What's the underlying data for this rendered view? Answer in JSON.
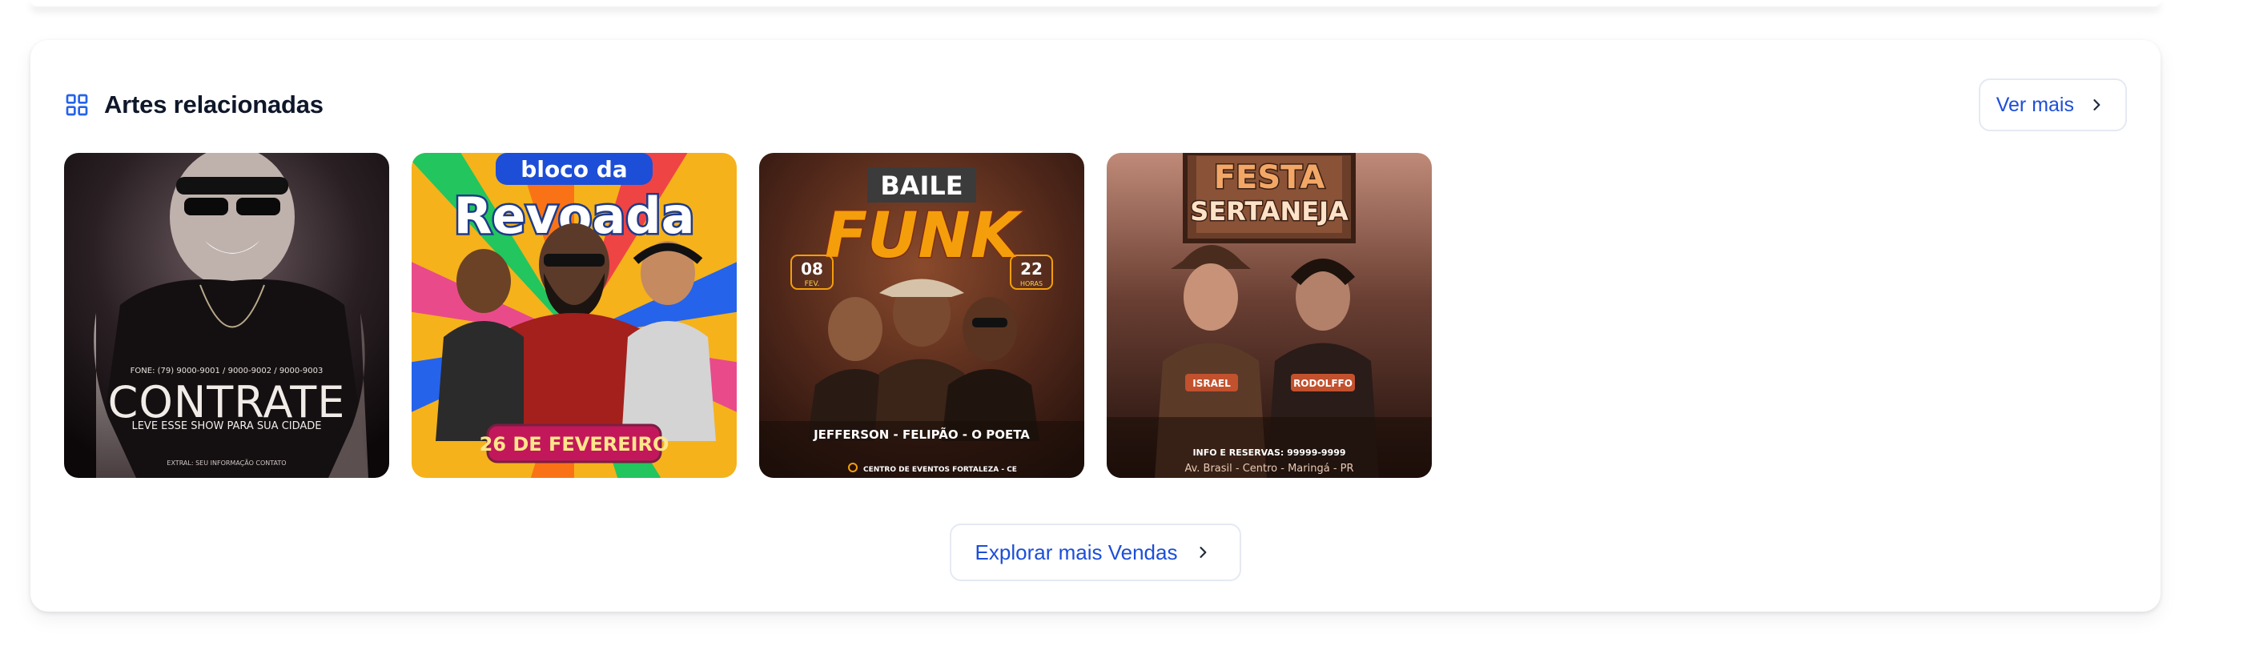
{
  "section": {
    "title": "Artes relacionadas",
    "ver_mais_label": "Ver mais",
    "explore_label": "Explorar mais Vendas"
  },
  "artworks": [
    {
      "name": "contrate",
      "headline": "CONTRATE",
      "tagline": "LEVE ESSE SHOW PARA SUA CIDADE",
      "phones": "FONE: (79) 9000-9001 / 9000-9002 / 9000-9003",
      "footer": "EXTRAL: SEU INFORMAÇÃO CONTATO",
      "palette": [
        "#151015",
        "#3a2a30",
        "#6b5a5e"
      ]
    },
    {
      "name": "bloco-da-revoada",
      "title_top": "bloco da",
      "title_main": "Revoada",
      "date": "26 DE FEVEREIRO",
      "palette": [
        "#f5b21b",
        "#e94b8a",
        "#2563eb",
        "#7c2d12"
      ]
    },
    {
      "name": "baile-funk",
      "title_top": "BAILE",
      "title_main": "FUNK",
      "day": "08",
      "month": "FEV.",
      "hour": "22",
      "hour_label": "HORAS",
      "artists": "JEFFERSON -  FELIPÃO -  O POETA",
      "venue": "CENTRO DE EVENTOS FORTALEZA - CE",
      "palette": [
        "#3b1f17",
        "#7a3a22",
        "#f59e0b"
      ]
    },
    {
      "name": "festa-sertaneja",
      "title_top": "FESTA",
      "title_main": "SERTANEJA",
      "artist_1": "ISRAEL",
      "artist_2": "RODOLFFO",
      "info": "INFO E RESERVAS: 99999-9999",
      "address": "Av. Brasil - Centro - Maringá - PR",
      "palette": [
        "#2a1712",
        "#7b4a37",
        "#f3a766"
      ]
    }
  ],
  "icons": {
    "section": "grid-icon",
    "ver_mais": "chevron-right-icon",
    "explore": "chevron-right-icon"
  }
}
